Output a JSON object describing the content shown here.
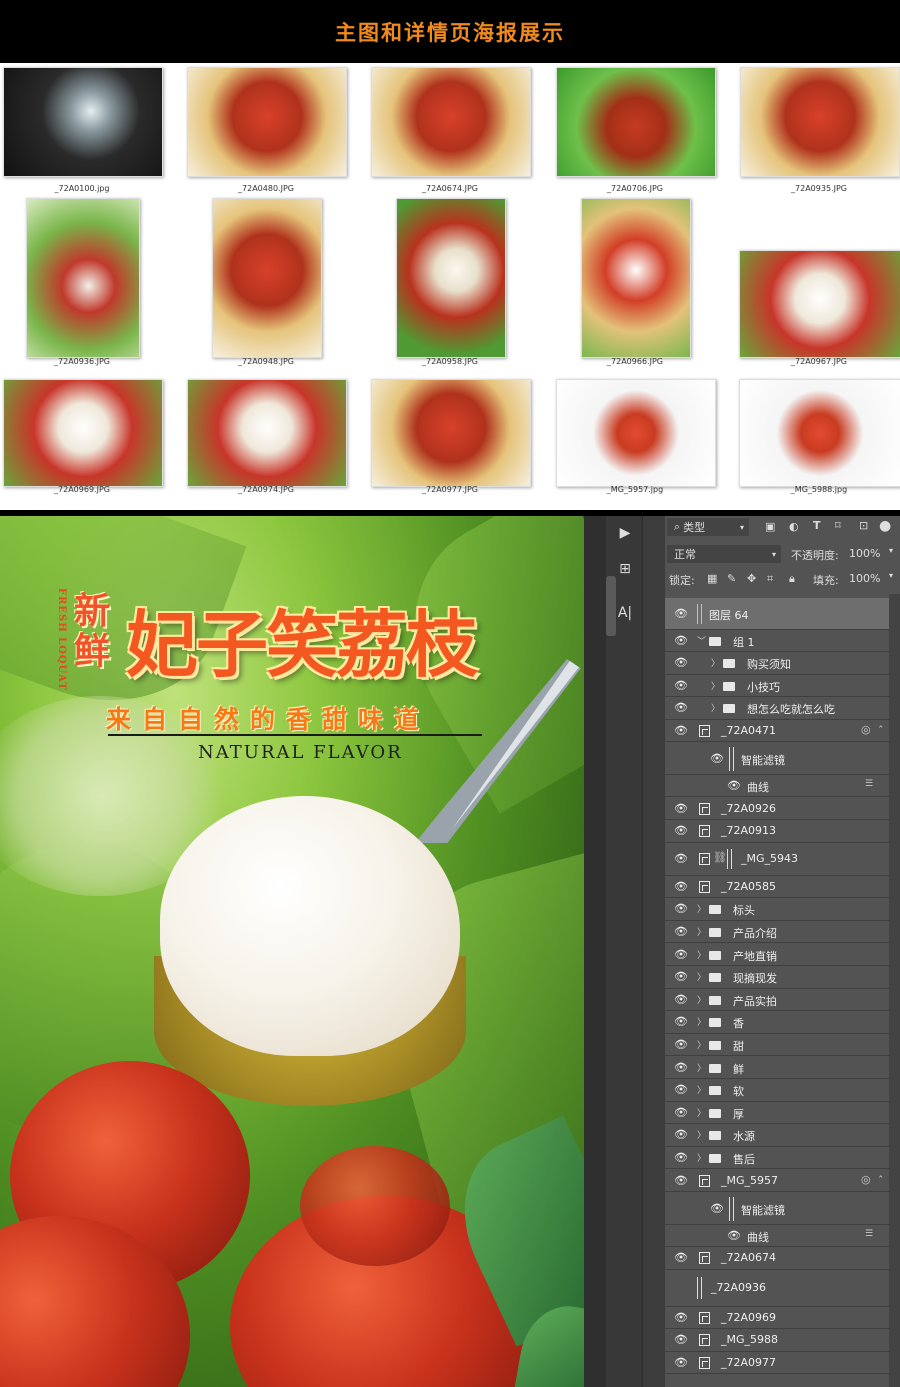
{
  "banner": {
    "title": "主图和详情页海报展示"
  },
  "thumbnails": [
    {
      "caption": "_72A0100.jpg",
      "kind": "waterfall"
    },
    {
      "caption": "_72A0480.JPG",
      "kind": "basket"
    },
    {
      "caption": "_72A0674.JPG",
      "kind": "basket"
    },
    {
      "caption": "_72A0706.JPG",
      "kind": "green"
    },
    {
      "caption": "_72A0935.JPG",
      "kind": "basket"
    },
    {
      "caption": "_72A0936.JPG",
      "kind": "hanging"
    },
    {
      "caption": "_72A0948.JPG",
      "kind": "basket"
    },
    {
      "caption": "_72A0958.JPG",
      "kind": "fork"
    },
    {
      "caption": "_72A0966.JPG",
      "kind": "stack"
    },
    {
      "caption": "_72A0967.JPG",
      "kind": "open"
    },
    {
      "caption": "_72A0969.JPG",
      "kind": "open"
    },
    {
      "caption": "_72A0974.JPG",
      "kind": "open"
    },
    {
      "caption": "_72A0977.JPG",
      "kind": "basket"
    },
    {
      "caption": "_MG_5957.jpg",
      "kind": "white"
    },
    {
      "caption": "_MG_5988.jpg",
      "kind": "white"
    }
  ],
  "poster": {
    "side_text": "FRESH LOQUAT",
    "new_text": "新鲜",
    "title": "妃子笑荔枝",
    "subtitle": "来自自然的香甜味道",
    "english": "NATURAL FLAVOR"
  },
  "photoshop": {
    "filter_kind": "类型",
    "blend_mode": "正常",
    "opacity_label": "不透明度:",
    "opacity_value": "100%",
    "lock_label": "锁定:",
    "fill_label": "填充:",
    "fill_value": "100%",
    "layers": [
      {
        "name": "图层 64",
        "type": "pixel",
        "indent": 0,
        "selected": true
      },
      {
        "name": "组 1",
        "type": "group-open",
        "indent": 0
      },
      {
        "name": "购买须知",
        "type": "group",
        "indent": 1
      },
      {
        "name": "小技巧",
        "type": "group",
        "indent": 1
      },
      {
        "name": "想怎么吃就怎么吃",
        "type": "group",
        "indent": 1
      },
      {
        "name": "_72A0471",
        "type": "smart",
        "indent": 0,
        "fx": true
      },
      {
        "name": "智能滤镜",
        "type": "filter-head",
        "indent": 0
      },
      {
        "name": "曲线",
        "type": "filter",
        "indent": 0
      },
      {
        "name": "_72A0926",
        "type": "smart",
        "indent": 0
      },
      {
        "name": "_72A0913",
        "type": "smart",
        "indent": 0
      },
      {
        "name": "_MG_5943",
        "type": "smart-link",
        "indent": 0
      },
      {
        "name": "_72A0585",
        "type": "smart",
        "indent": 0
      },
      {
        "name": "标头",
        "type": "group",
        "indent": 0
      },
      {
        "name": "产品介绍",
        "type": "group",
        "indent": 0
      },
      {
        "name": "产地直销",
        "type": "group",
        "indent": 0
      },
      {
        "name": "现摘现发",
        "type": "group",
        "indent": 0
      },
      {
        "name": "产品实拍",
        "type": "group",
        "indent": 0
      },
      {
        "name": "香",
        "type": "group",
        "indent": 0
      },
      {
        "name": "甜",
        "type": "group",
        "indent": 0
      },
      {
        "name": "鲜",
        "type": "group",
        "indent": 0
      },
      {
        "name": "软",
        "type": "group",
        "indent": 0
      },
      {
        "name": "厚",
        "type": "group",
        "indent": 0
      },
      {
        "name": "水源",
        "type": "group",
        "indent": 0
      },
      {
        "name": "售后",
        "type": "group",
        "indent": 0
      },
      {
        "name": "_MG_5957",
        "type": "smart",
        "indent": 0,
        "fx": true
      },
      {
        "name": "智能滤镜",
        "type": "filter-head",
        "indent": 0
      },
      {
        "name": "曲线",
        "type": "filter",
        "indent": 0
      },
      {
        "name": "_72A0674",
        "type": "smart",
        "indent": 0
      },
      {
        "name": "_72A0936",
        "type": "pixel-noeye",
        "indent": 0
      },
      {
        "name": "_72A0969",
        "type": "smart",
        "indent": 0
      },
      {
        "name": "_MG_5988",
        "type": "smart",
        "indent": 0
      },
      {
        "name": "_72A0977",
        "type": "smart",
        "indent": 0
      }
    ]
  },
  "colors": {
    "accent": "#f08a1c",
    "ps_panel": "#535353",
    "ps_selected": "#6e6e6e"
  }
}
